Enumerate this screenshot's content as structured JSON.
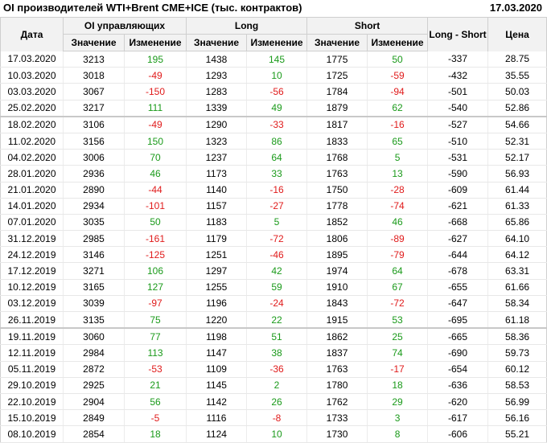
{
  "header": {
    "title": "OI производителей WTI+Brent CME+ICE (тыс. контрактов)",
    "date": "17.03.2020"
  },
  "table": {
    "col_date": "Дата",
    "group_oi": "OI управляющих",
    "group_long": "Long",
    "group_short": "Short",
    "col_long_short": "Long - Short",
    "col_price": "Цена",
    "sub_value": "Значение",
    "sub_change": "Изменение",
    "rows": [
      [
        "17.03.2020",
        "3213",
        "195",
        "1438",
        "145",
        "1775",
        "50",
        "-337",
        "28.75"
      ],
      [
        "10.03.2020",
        "3018",
        "-49",
        "1293",
        "10",
        "1725",
        "-59",
        "-432",
        "35.55"
      ],
      [
        "03.03.2020",
        "3067",
        "-150",
        "1283",
        "-56",
        "1784",
        "-94",
        "-501",
        "50.03"
      ],
      [
        "25.02.2020",
        "3217",
        "111",
        "1339",
        "49",
        "1879",
        "62",
        "-540",
        "52.86"
      ],
      [
        "18.02.2020",
        "3106",
        "-49",
        "1290",
        "-33",
        "1817",
        "-16",
        "-527",
        "54.66"
      ],
      [
        "11.02.2020",
        "3156",
        "150",
        "1323",
        "86",
        "1833",
        "65",
        "-510",
        "52.31"
      ],
      [
        "04.02.2020",
        "3006",
        "70",
        "1237",
        "64",
        "1768",
        "5",
        "-531",
        "52.17"
      ],
      [
        "28.01.2020",
        "2936",
        "46",
        "1173",
        "33",
        "1763",
        "13",
        "-590",
        "56.93"
      ],
      [
        "21.01.2020",
        "2890",
        "-44",
        "1140",
        "-16",
        "1750",
        "-28",
        "-609",
        "61.44"
      ],
      [
        "14.01.2020",
        "2934",
        "-101",
        "1157",
        "-27",
        "1778",
        "-74",
        "-621",
        "61.33"
      ],
      [
        "07.01.2020",
        "3035",
        "50",
        "1183",
        "5",
        "1852",
        "46",
        "-668",
        "65.86"
      ],
      [
        "31.12.2019",
        "2985",
        "-161",
        "1179",
        "-72",
        "1806",
        "-89",
        "-627",
        "64.10"
      ],
      [
        "24.12.2019",
        "3146",
        "-125",
        "1251",
        "-46",
        "1895",
        "-79",
        "-644",
        "64.12"
      ],
      [
        "17.12.2019",
        "3271",
        "106",
        "1297",
        "42",
        "1974",
        "64",
        "-678",
        "63.31"
      ],
      [
        "10.12.2019",
        "3165",
        "127",
        "1255",
        "59",
        "1910",
        "67",
        "-655",
        "61.66"
      ],
      [
        "03.12.2019",
        "3039",
        "-97",
        "1196",
        "-24",
        "1843",
        "-72",
        "-647",
        "58.34"
      ],
      [
        "26.11.2019",
        "3135",
        "75",
        "1220",
        "22",
        "1915",
        "53",
        "-695",
        "61.18"
      ],
      [
        "19.11.2019",
        "3060",
        "77",
        "1198",
        "51",
        "1862",
        "25",
        "-665",
        "58.36"
      ],
      [
        "12.11.2019",
        "2984",
        "113",
        "1147",
        "38",
        "1837",
        "74",
        "-690",
        "59.73"
      ],
      [
        "05.11.2019",
        "2872",
        "-53",
        "1109",
        "-36",
        "1763",
        "-17",
        "-654",
        "60.12"
      ],
      [
        "29.10.2019",
        "2925",
        "21",
        "1145",
        "2",
        "1780",
        "18",
        "-636",
        "58.53"
      ],
      [
        "22.10.2019",
        "2904",
        "56",
        "1142",
        "26",
        "1762",
        "29",
        "-620",
        "56.99"
      ],
      [
        "15.10.2019",
        "2849",
        "-5",
        "1116",
        "-8",
        "1733",
        "3",
        "-617",
        "56.16"
      ],
      [
        "08.10.2019",
        "2854",
        "18",
        "1124",
        "10",
        "1730",
        "8",
        "-606",
        "55.21"
      ]
    ],
    "separator_after_rows": [
      3,
      16
    ],
    "colors": {
      "positive": "#1a9a1a",
      "negative": "#e01b1b"
    }
  }
}
